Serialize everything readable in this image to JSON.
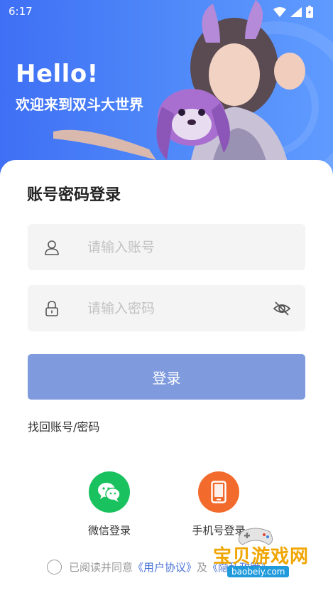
{
  "status_bar": {
    "time": "6:17"
  },
  "hero": {
    "title": "Hello!",
    "subtitle": "欢迎来到双斗大世界"
  },
  "form": {
    "title": "账号密码登录",
    "account_placeholder": "请输入账号",
    "password_placeholder": "请输入密码",
    "login_label": "登录",
    "forgot_label": "找回账号/密码"
  },
  "social": {
    "wechat_label": "微信登录",
    "phone_label": "手机号登录"
  },
  "agreement": {
    "prefix": "已阅读并同意",
    "user_agreement": "《用户协议》",
    "joiner": "及",
    "privacy_policy": "《隐私政策》"
  },
  "watermark": {
    "text": "宝贝游戏网",
    "url": "baobeiy.com"
  },
  "colors": {
    "hero_blue": "#4d86f8",
    "button_disabled": "#7f9bde",
    "wechat_green": "#19c25e",
    "phone_orange": "#f26b2c",
    "link_blue": "#4a73d6"
  },
  "icons": [
    "wifi-icon",
    "signal-icon",
    "battery-icon",
    "user-icon",
    "lock-icon",
    "eye-off-icon",
    "wechat-icon",
    "phone-icon"
  ]
}
